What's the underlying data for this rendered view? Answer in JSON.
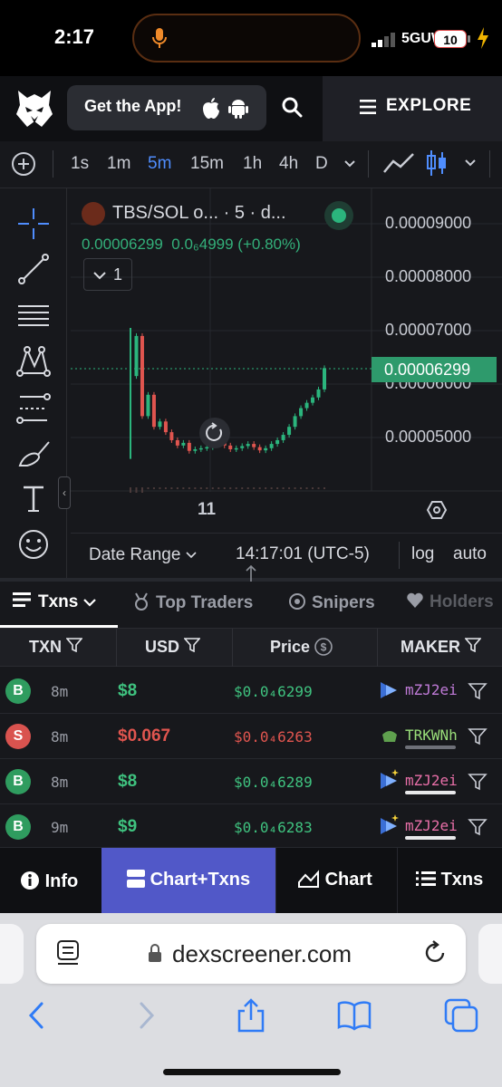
{
  "status_bar": {
    "time": "2:17",
    "network": "5GUW",
    "battery": "10"
  },
  "header": {
    "get_app": "Get the App!",
    "explore": "EXPLORE"
  },
  "toolbar": {
    "timeframes": [
      "1s",
      "1m",
      "5m",
      "15m",
      "1h",
      "4h",
      "D"
    ],
    "active_timeframe": "5m"
  },
  "chart": {
    "symbol_title": "TBS/SOL o... · 5 · d...",
    "ohlc_price": "0.00006299",
    "ohlc_change": "0.0₆4999 (+0.80%)",
    "indicator_count": "1",
    "y_axis_labels": [
      "0.00009000",
      "0.00008000",
      "0.00007000",
      "0.00006000",
      "0.00005000"
    ],
    "last_price_label": "0.00006299",
    "x_axis_label": "11",
    "date_range": "Date Range",
    "clock": "14:17:01 (UTC-5)",
    "log": "log",
    "auto": "auto",
    "accent_up": "#2bb57d",
    "accent_down": "#e0554f"
  },
  "chart_data": {
    "type": "line",
    "ylim": [
      4.3e-05,
      9.3e-05
    ],
    "y_ticks": [
      9e-05,
      8e-05,
      7e-05,
      6e-05,
      5e-05
    ],
    "series": [
      {
        "values": [
          6.15e-05,
          6.9e-05,
          5.4e-05,
          5.8e-05,
          5.2e-05,
          5.3e-05,
          5.1e-05,
          4.95e-05,
          4.85e-05,
          4.9e-05,
          4.75e-05,
          4.78e-05,
          4.8e-05,
          4.82e-05,
          4.88e-05,
          4.92e-05,
          4.85e-05,
          4.78e-05,
          4.8e-05,
          4.84e-05,
          4.88e-05,
          4.82e-05,
          4.76e-05,
          4.8e-05,
          4.88e-05,
          4.95e-05,
          5.05e-05,
          5.2e-05,
          5.4e-05,
          5.55e-05,
          5.65e-05,
          5.75e-05,
          5.9e-05,
          6.299e-05
        ]
      }
    ]
  },
  "tabs": {
    "txns": "Txns",
    "top_traders": "Top Traders",
    "snipers": "Snipers",
    "holders": "Holders"
  },
  "table": {
    "headers": {
      "txn": "TXN",
      "usd": "USD",
      "price": "Price",
      "maker": "MAKER"
    },
    "rows": [
      {
        "type": "B",
        "age": "8m",
        "usd": "$8",
        "price": "$0.0₄6299",
        "maker": "mZJ2ei"
      },
      {
        "type": "S",
        "age": "8m",
        "usd": "$0.067",
        "price": "$0.0₄6263",
        "maker": "TRKWNh"
      },
      {
        "type": "B",
        "age": "8m",
        "usd": "$8",
        "price": "$0.0₄6289",
        "maker": "mZJ2ei"
      },
      {
        "type": "B",
        "age": "9m",
        "usd": "$9",
        "price": "$0.0₄6283",
        "maker": "mZJ2ei"
      }
    ]
  },
  "bottom_nav": {
    "info": "Info",
    "chart_txns": "Chart+Txns",
    "chart": "Chart",
    "txns": "Txns"
  },
  "browser": {
    "url": "dexscreener.com"
  }
}
